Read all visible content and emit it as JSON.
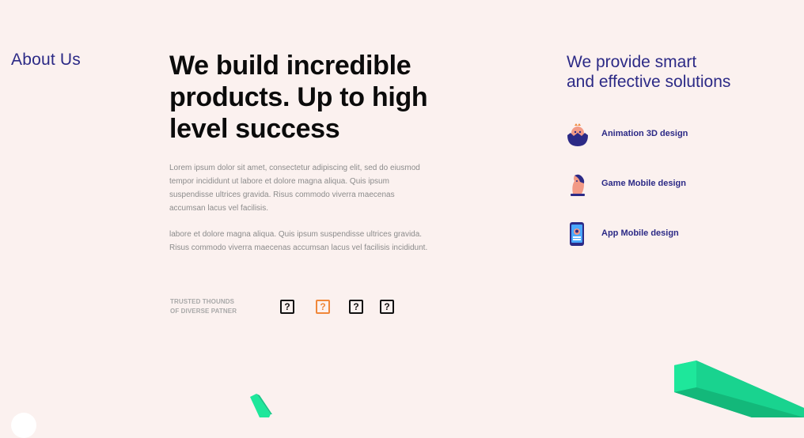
{
  "about": {
    "label": "About Us"
  },
  "main": {
    "headline": "We build incredible products. Up to high level success",
    "paragraph_1": "Lorem ipsum dolor sit amet, consectetur adipiscing elit, sed do eiusmod tempor incididunt ut labore et dolore magna aliqua. Quis ipsum suspendisse ultrices gravida. Risus commodo viverra maecenas accumsan lacus vel facilisis.",
    "paragraph_2": "labore et dolore magna aliqua. Quis ipsum suspendisse ultrices gravida. Risus commodo viverra maecenas accumsan lacus vel facilisis incididunt."
  },
  "trusted": {
    "line_1": "TRUSTED THOUNDS",
    "line_2": "OF DIVERSE PATNER",
    "logos": [
      {
        "glyph": "?",
        "color": "#111111"
      },
      {
        "glyph": "?",
        "color": "#f0873a"
      },
      {
        "glyph": "?",
        "color": "#111111"
      },
      {
        "glyph": "?",
        "color": "#111111"
      }
    ]
  },
  "solutions": {
    "heading_line_1": "We provide smart",
    "heading_line_2": "and effective solutions",
    "services": [
      {
        "label": "Animation 3D design",
        "icon": "chick-egg-icon"
      },
      {
        "label": "Game Mobile design",
        "icon": "chess-knight-icon"
      },
      {
        "label": "App Mobile design",
        "icon": "mobile-app-icon"
      }
    ]
  },
  "colors": {
    "background": "#fbf1ef",
    "accent_navy": "#2c2a86",
    "accent_orange": "#f0873a",
    "accent_green": "#19e39a",
    "text_dark": "#0b0b0b",
    "text_muted": "#8c8c8c"
  }
}
